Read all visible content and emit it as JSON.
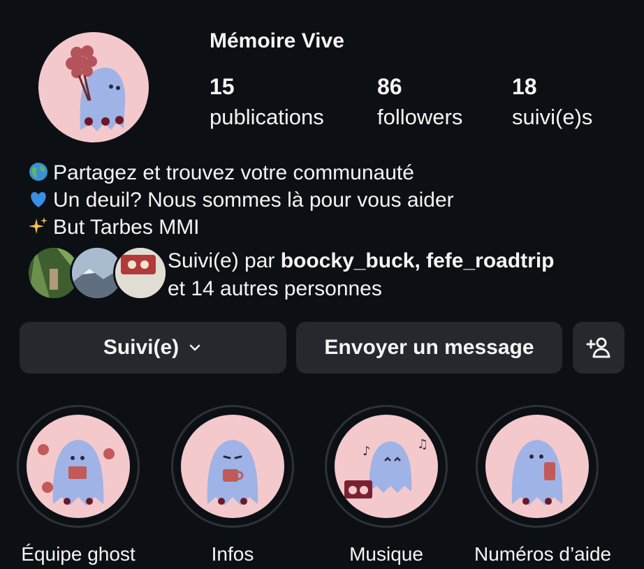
{
  "profile": {
    "username": "Mémoire Vive",
    "stats": [
      {
        "value": "15",
        "label": "publications"
      },
      {
        "value": "86",
        "label": "followers"
      },
      {
        "value": "18",
        "label": "suivi(e)s"
      }
    ],
    "bio": [
      {
        "icon": "globe-icon",
        "text": "Partagez et trouvez votre communauté"
      },
      {
        "icon": "blue-heart-icon",
        "text": "Un deuil? Nous sommes là pour vous aider"
      },
      {
        "icon": "sparkles-icon",
        "text": "But Tarbes MMI"
      }
    ],
    "followed_by": {
      "prefix": "Suivi(e) par ",
      "names": "boocky_buck, fefe_roadtrip",
      "others": "et 14 autres personnes"
    }
  },
  "actions": {
    "follow_label": "Suivi(e)",
    "message_label": "Envoyer un message",
    "add_user_icon": "add-user-icon"
  },
  "highlights": [
    {
      "label": "Équipe ghost"
    },
    {
      "label": "Infos"
    },
    {
      "label": "Musique"
    },
    {
      "label": "Numéros d’aide"
    }
  ],
  "colors": {
    "background": "#0c1014",
    "button": "#25292e",
    "avatar_bg": "#f4c9cc",
    "ghost": "#9fb3e6"
  }
}
